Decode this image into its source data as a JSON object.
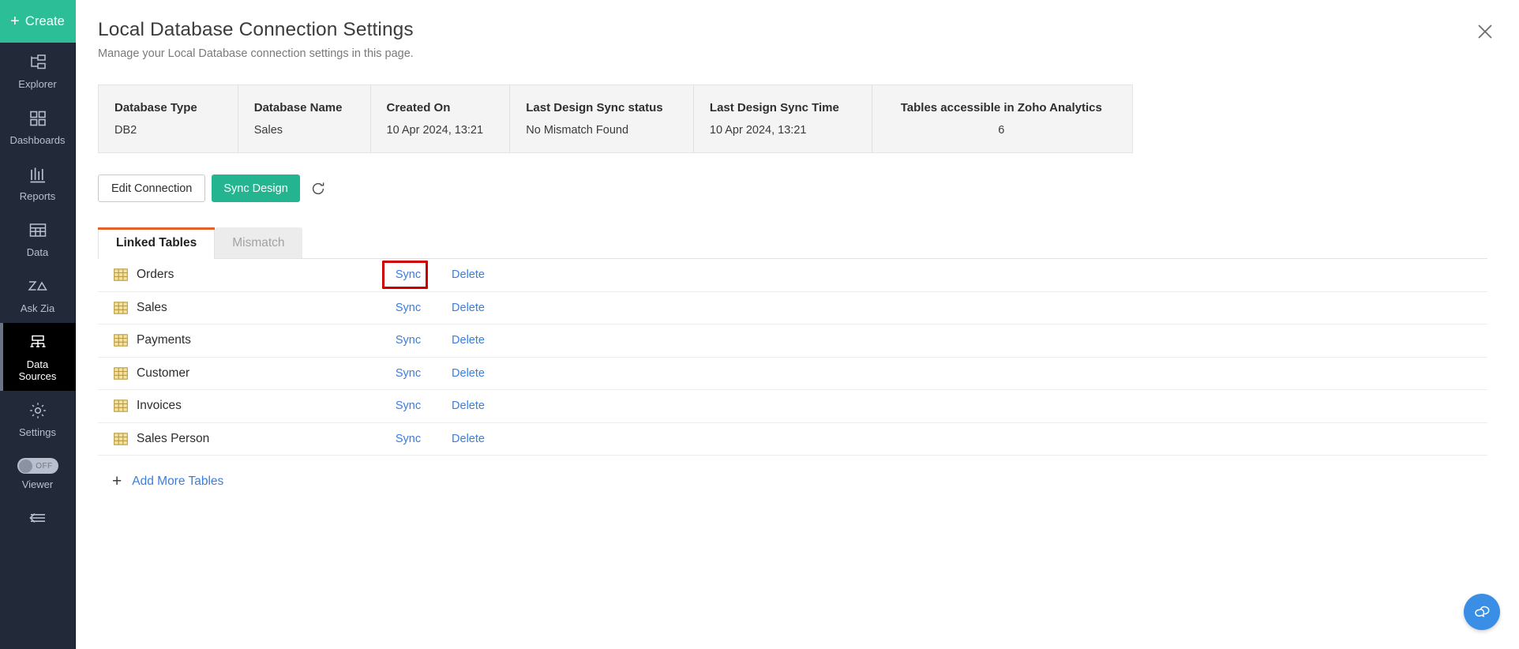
{
  "sidebar": {
    "create_label": "Create",
    "items": [
      {
        "label": "Explorer",
        "icon": "explorer-icon",
        "active": false
      },
      {
        "label": "Dashboards",
        "icon": "dashboards-icon",
        "active": false
      },
      {
        "label": "Reports",
        "icon": "reports-icon",
        "active": false
      },
      {
        "label": "Data",
        "icon": "data-icon",
        "active": false
      },
      {
        "label": "Ask Zia",
        "icon": "ask-zia-icon",
        "active": false
      },
      {
        "label": "Data\nSources",
        "icon": "data-sources-icon",
        "active": true
      },
      {
        "label": "Settings",
        "icon": "gear-icon",
        "active": false
      }
    ],
    "data_sources_line1": "Data",
    "data_sources_line2": "Sources",
    "viewer": {
      "label": "Viewer",
      "state": "OFF"
    },
    "collapse_icon": "collapse-left-icon"
  },
  "header": {
    "title": "Local Database Connection Settings",
    "subtitle": "Manage your Local Database connection settings in this page.",
    "close_icon": "close-icon"
  },
  "info_table": {
    "columns": [
      {
        "header": "Database Type",
        "value": "DB2"
      },
      {
        "header": "Database Name",
        "value": "Sales"
      },
      {
        "header": "Created On",
        "value": "10 Apr 2024, 13:21"
      },
      {
        "header": "Last Design Sync status",
        "value": "No Mismatch Found"
      },
      {
        "header": "Last Design Sync Time",
        "value": "10 Apr 2024, 13:21"
      },
      {
        "header": "Tables accessible in Zoho Analytics",
        "value": "6"
      }
    ]
  },
  "actions": {
    "edit_connection": "Edit Connection",
    "sync_design": "Sync Design",
    "refresh_icon": "refresh-icon"
  },
  "tabs": [
    {
      "label": "Linked Tables",
      "active": true
    },
    {
      "label": "Mismatch",
      "active": false
    }
  ],
  "rows": [
    {
      "name": "Orders",
      "sync": "Sync",
      "delete": "Delete",
      "highlighted": true
    },
    {
      "name": "Sales",
      "sync": "Sync",
      "delete": "Delete",
      "highlighted": false
    },
    {
      "name": "Payments",
      "sync": "Sync",
      "delete": "Delete",
      "highlighted": false
    },
    {
      "name": "Customer",
      "sync": "Sync",
      "delete": "Delete",
      "highlighted": false
    },
    {
      "name": "Invoices",
      "sync": "Sync",
      "delete": "Delete",
      "highlighted": false
    },
    {
      "name": "Sales Person",
      "sync": "Sync",
      "delete": "Delete",
      "highlighted": false
    }
  ],
  "add_more": {
    "label": "Add More Tables",
    "icon": "plus-icon"
  },
  "chat": {
    "icon": "chat-bubble-icon"
  },
  "colors": {
    "sidebar_bg": "#222938",
    "create_green": "#2cbf97",
    "sync_green": "#24b590",
    "link_blue": "#3b7ddd",
    "tab_accent": "#e1622a",
    "highlight_red": "#cc0000",
    "chat_blue": "#3a8ee6",
    "table_icon_gold": "#e9c96a"
  }
}
